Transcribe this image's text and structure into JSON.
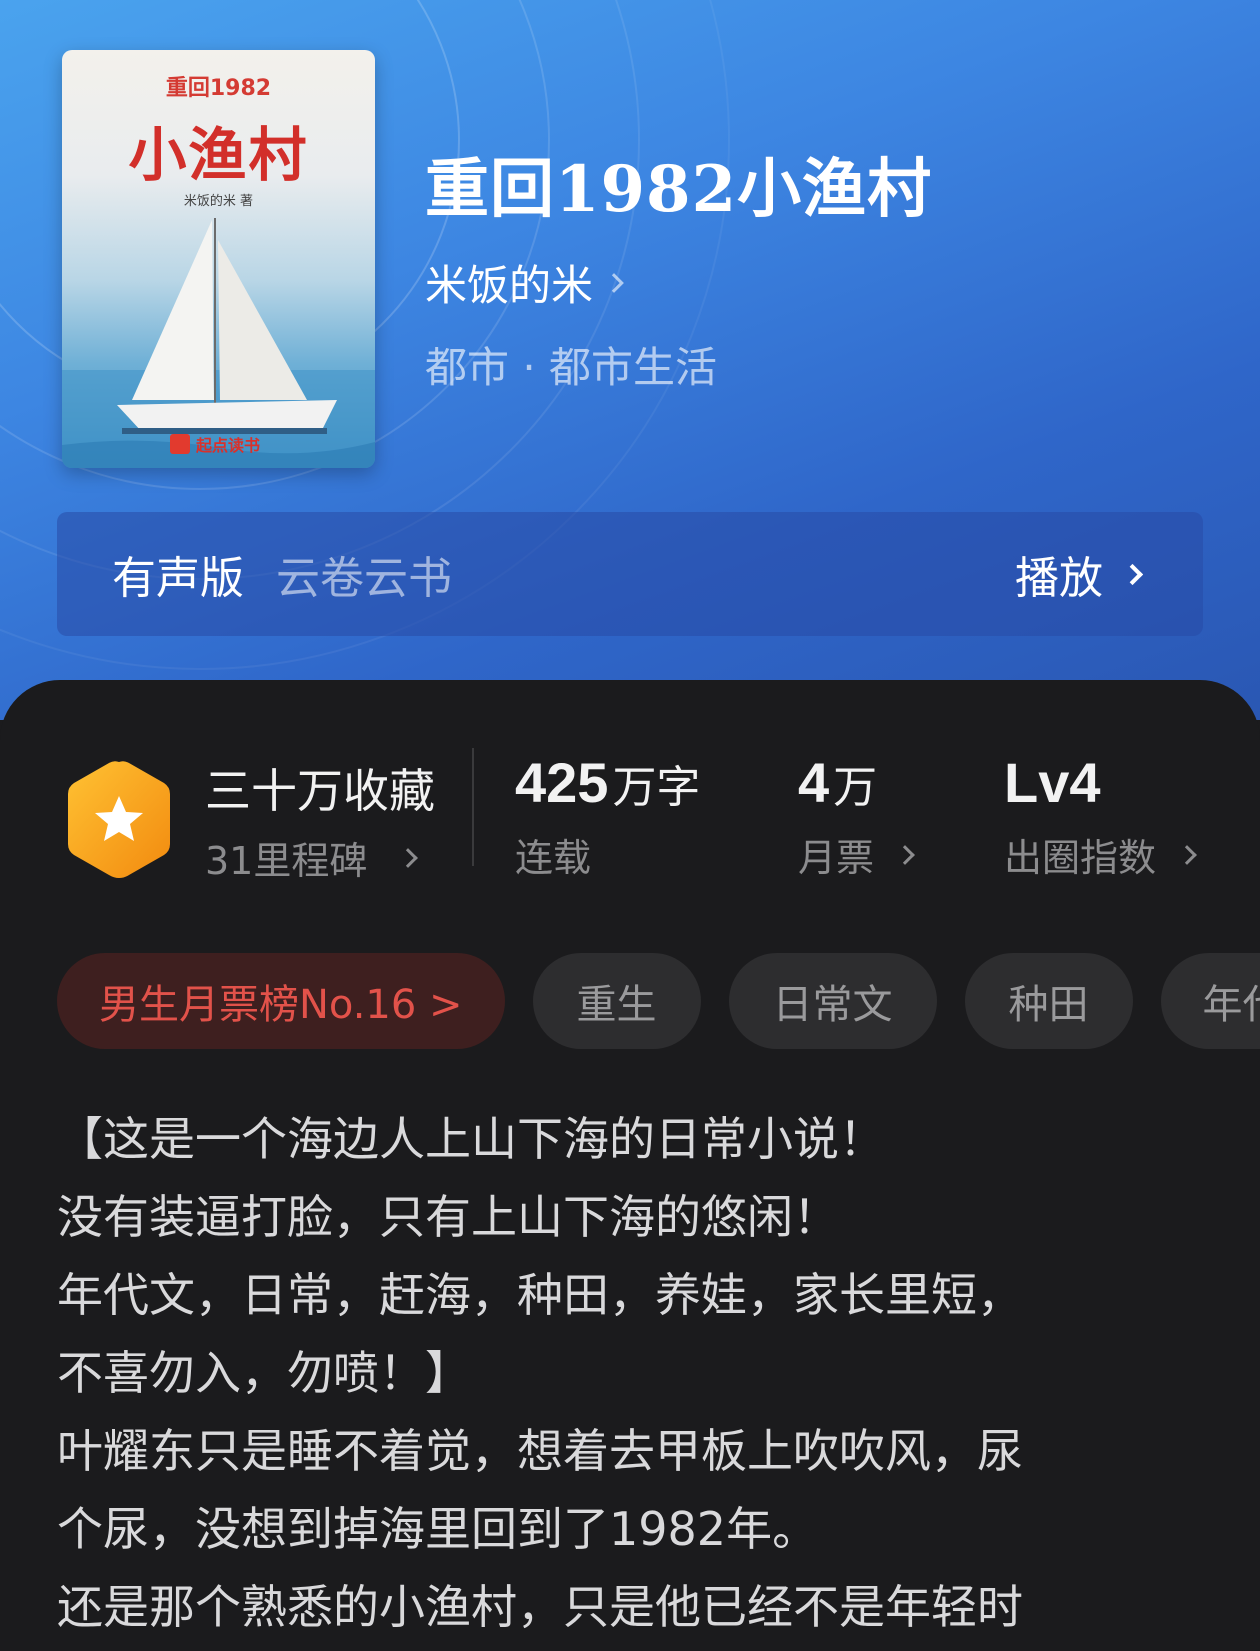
{
  "book": {
    "title": "重回1982小渔村",
    "author": "米饭的米",
    "genre": "都市 · 都市生活"
  },
  "cover": {
    "sup_title": "重回1982",
    "main_title": "小渔村",
    "author_line": "米饭的米 著",
    "brand": "起点读书"
  },
  "audio": {
    "label": "有声版",
    "narrator": "云卷云书",
    "play_label": "播放"
  },
  "stats": {
    "favorites": "三十万收藏",
    "milestones": "31里程碑",
    "words_num": "425",
    "words_unit": "万字",
    "status": "连载",
    "monthly_num": "4",
    "monthly_unit": "万",
    "monthly_label": "月票",
    "level": "Lv4",
    "level_label": "出圈指数"
  },
  "tags": {
    "rank": "男生月票榜No.16 >",
    "items": [
      "重生",
      "日常文",
      "种田",
      "年代"
    ]
  },
  "description": [
    "【这是一个海边人上山下海的日常小说！",
    "没有装逼打脸，只有上山下海的悠闲！",
    "年代文，日常，赶海，种田，养娃，家长里短，",
    "不喜勿入，勿喷！】",
    "叶耀东只是睡不着觉，想着去甲板上吹吹风，尿",
    "个尿，没想到掉海里回到了1982年。",
    "还是那个熟悉的小渔村，只是他已经不是年轻时"
  ],
  "colors": {
    "accent_blue": "#3d86e2",
    "rank_red": "#e2524a",
    "badge_orange": "#f7a21b",
    "panel_bg": "#1b1b1d"
  }
}
